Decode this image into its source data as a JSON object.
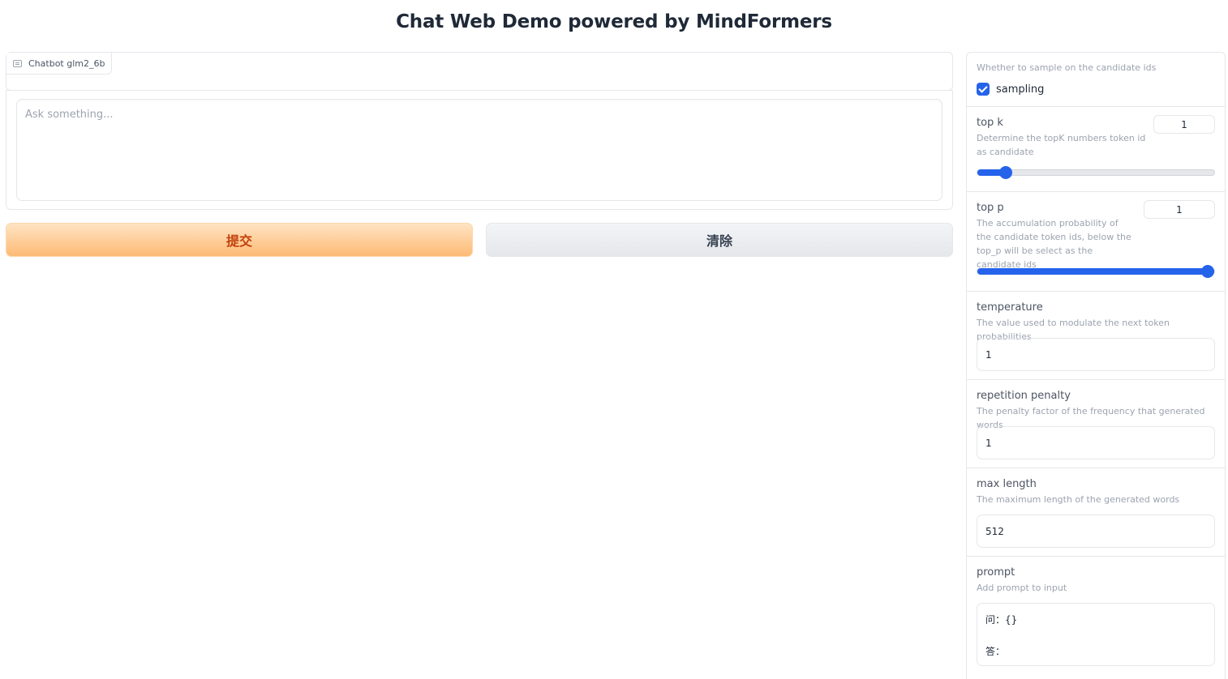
{
  "header": {
    "title": "Chat Web Demo powered by MindFormers"
  },
  "chatbot": {
    "label": "Chatbot glm2_6b",
    "icon": "chat-icon"
  },
  "input": {
    "placeholder": "Ask something..."
  },
  "buttons": {
    "submit_label": "提交",
    "clear_label": "清除"
  },
  "settings": {
    "sampling": {
      "info": "Whether to sample on the candidate ids",
      "label": "sampling",
      "checked": true
    },
    "top_k": {
      "label": "top k",
      "info": "Determine the topK numbers token id as candidate",
      "value": "1",
      "slider_fraction": 0.12
    },
    "top_p": {
      "label": "top p",
      "info": "The accumulation probability of the candidate token ids, below the top_p will be select as the candidate ids",
      "value": "1",
      "slider_fraction": 1.0
    },
    "temperature": {
      "label": "temperature",
      "info": "The value used to modulate the next token probabilities",
      "value": "1"
    },
    "repetition_penalty": {
      "label": "repetition penalty",
      "info": "The penalty factor of the frequency that generated words",
      "value": "1"
    },
    "max_length": {
      "label": "max length",
      "info": "The maximum length of the generated words",
      "value": "512"
    },
    "prompt": {
      "label": "prompt",
      "info": "Add prompt to input",
      "line1": "问：{}",
      "line2": "答："
    }
  },
  "colors": {
    "accent": "#2563eb",
    "submit_text": "#c2410c",
    "submit_bg_start": "#ffe4c4",
    "submit_bg_end": "#fdba74"
  }
}
